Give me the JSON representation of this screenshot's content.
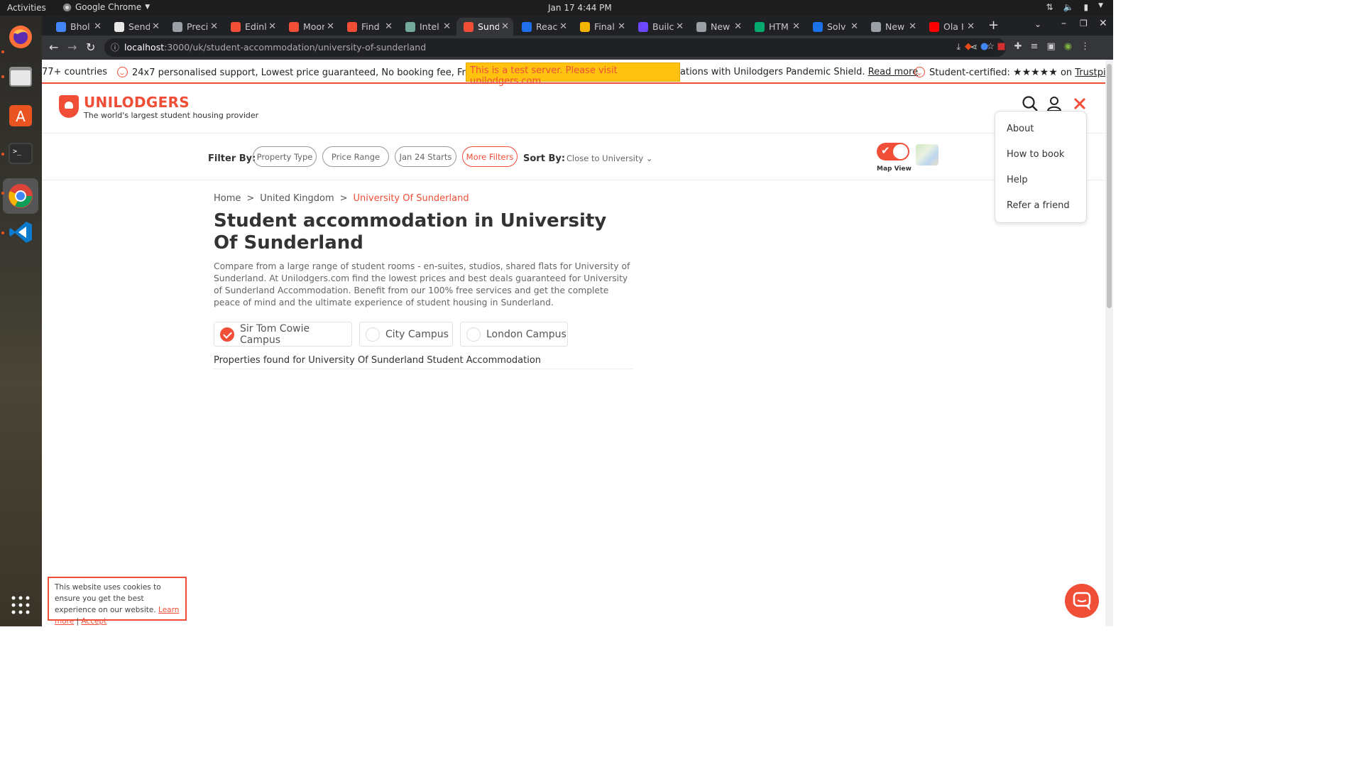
{
  "os": {
    "activities": "Activities",
    "app_name": "Google Chrome",
    "clock": "Jan 17  4:44 PM"
  },
  "tabs": [
    {
      "label": "Bhol",
      "color": "#4285f4"
    },
    {
      "label": "Send",
      "color": "#e8e8e8"
    },
    {
      "label": "Preci",
      "color": "#9aa0a6"
    },
    {
      "label": "Edinl",
      "color": "#f04e37"
    },
    {
      "label": "Moor",
      "color": "#f04e37"
    },
    {
      "label": "Find",
      "color": "#f04e37"
    },
    {
      "label": "Intel",
      "color": "#74aa9c"
    },
    {
      "label": "Sund",
      "color": "#f04e37",
      "active": true
    },
    {
      "label": "Reac",
      "color": "#1f6feb"
    },
    {
      "label": "Final",
      "color": "#f4b400"
    },
    {
      "label": "Builc",
      "color": "#6c47ff"
    },
    {
      "label": "New",
      "color": "#9aa0a6"
    },
    {
      "label": "HTM",
      "color": "#04aa6d"
    },
    {
      "label": "Solv",
      "color": "#1a73e8"
    },
    {
      "label": "New",
      "color": "#9aa0a6"
    },
    {
      "label": "Ola I",
      "color": "#ff0000"
    }
  ],
  "browser": {
    "url_host": "localhost",
    "url_path": ":3000/uk/student-accommodation/university-of-sunderland"
  },
  "ticker": {
    "countries": "77+ countries",
    "support": "24x7 personalised support, Lowest price guaranteed, No booking fee, Free cancellat",
    "pandemic": "ations with Unilodgers Pandemic Shield.",
    "read_more": "Read more",
    "certified": "Student-certified:",
    "stars": "★★★★★",
    "on": "on",
    "trustpilot": "Trustpilot"
  },
  "test_banner": "This is a test server. Please visit unilodgers.com",
  "brand": {
    "name": "UNILODGERS",
    "tagline": "The world's largest student housing provider",
    "accent": "#f04e37"
  },
  "filters": {
    "filter_by": "Filter By:",
    "chips": [
      "Property Type",
      "Price Range",
      "Jan 24 Starts",
      "More Filters"
    ],
    "sort_by": "Sort By:",
    "sort_value": "Close to University",
    "map_view": "Map View"
  },
  "menu": [
    "About",
    "How to book",
    "Help",
    "Refer a friend"
  ],
  "breadcrumb": [
    "Home",
    "United Kingdom",
    "University Of Sunderland"
  ],
  "heading": "Student accommodation in University Of Sunderland",
  "description": "Compare from a large range of student rooms - en-suites, studios, shared flats for University of Sunderland. At Unilodgers.com find the lowest prices and best deals guaranteed for University of Sunderland Accommodation. Benefit from our 100% free services and get the complete peace of mind and the ultimate experience of student housing in Sunderland.",
  "campuses": [
    {
      "label": "Sir Tom Cowie Campus",
      "selected": true
    },
    {
      "label": "City Campus",
      "selected": false
    },
    {
      "label": "London Campus",
      "selected": false
    }
  ],
  "properties_found": "Properties found for University Of Sunderland Student Accommodation",
  "cookie": {
    "text": "This website uses cookies to ensure you get the best experience on our website.",
    "learn_more": "Learn more",
    "separator": "|",
    "accept": "Accept"
  }
}
